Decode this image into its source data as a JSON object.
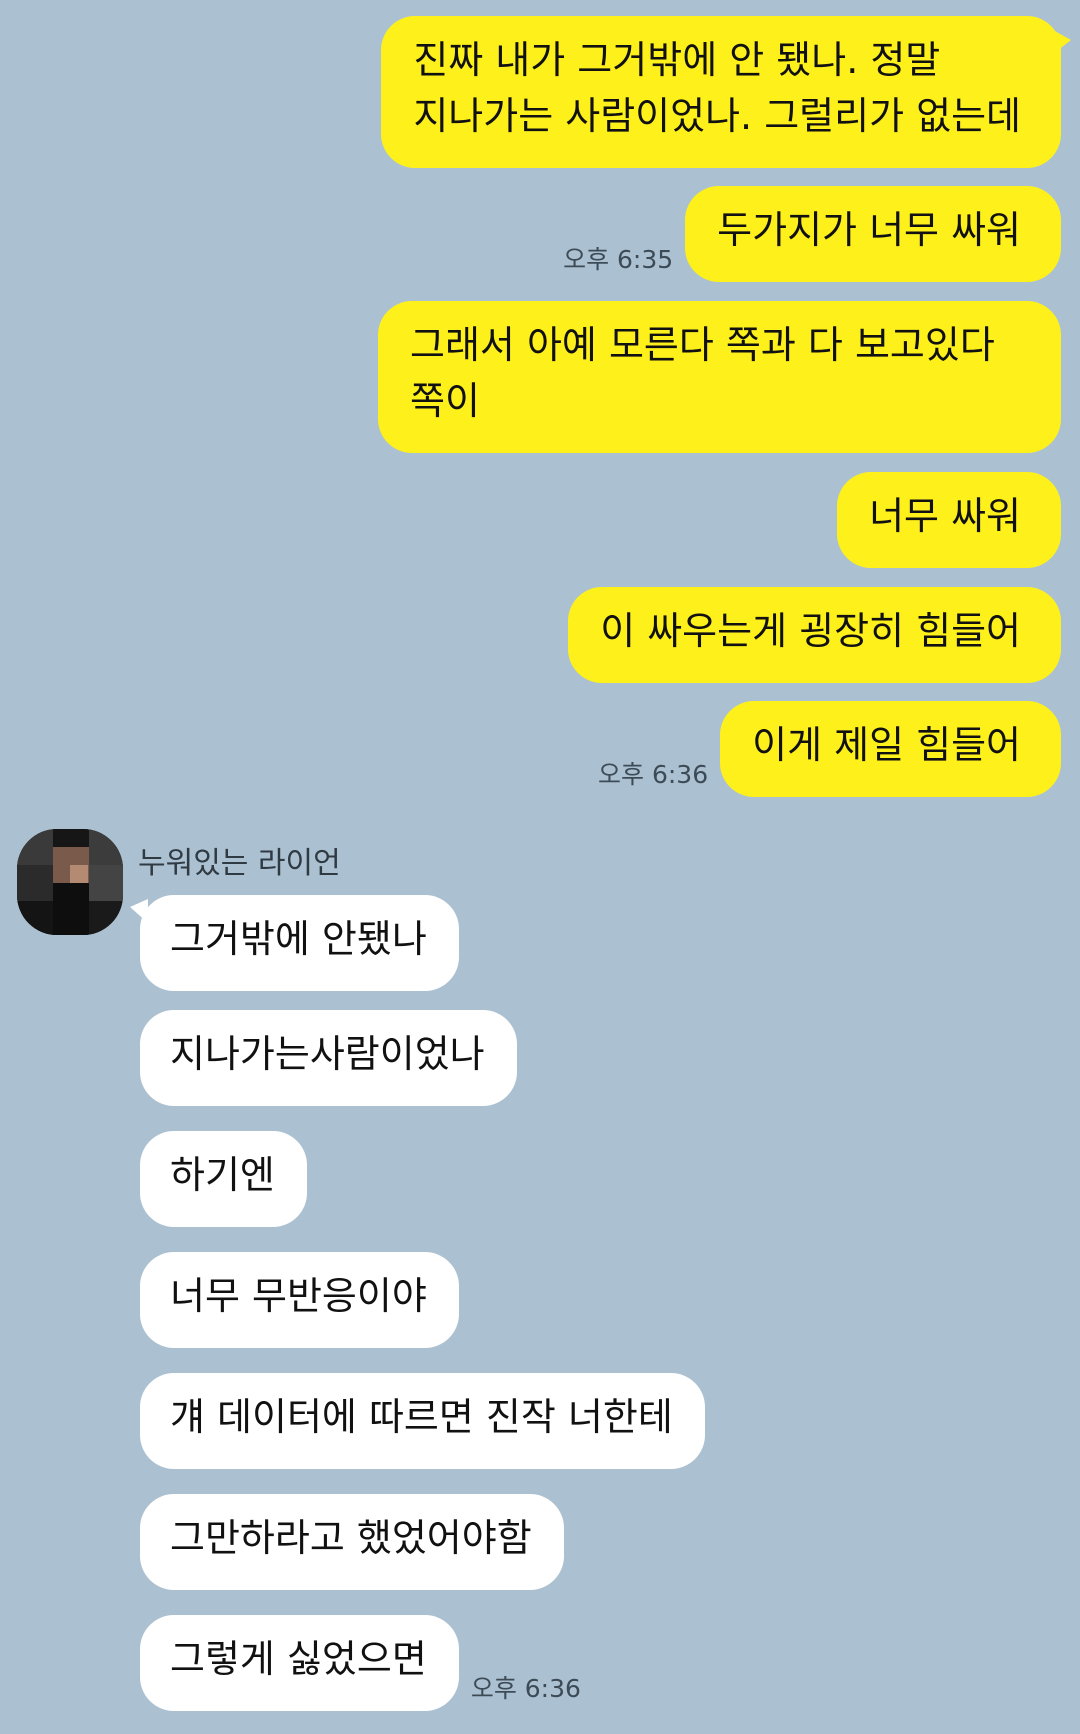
{
  "chat": {
    "outgoing": [
      {
        "text": "진짜 내가 그거밖에 안 됐나. 정말\n지나가는 사람이었나. 그럴리가 없는데",
        "time": ""
      },
      {
        "text": "두가지가 너무 싸워",
        "time": "오후 6:35"
      },
      {
        "text": "그래서 아예 모른다 쪽과 다 보고있다\n쪽이",
        "time": ""
      },
      {
        "text": "너무 싸워",
        "time": ""
      },
      {
        "text": "이 싸우는게 굉장히 힘들어",
        "time": ""
      },
      {
        "text": "이게 제일 힘들어",
        "time": "오후 6:36"
      }
    ],
    "sender_name": "누워있는 라이언",
    "incoming": [
      {
        "text": "그거밖에 안됐나",
        "time": ""
      },
      {
        "text": "지나가는사람이었나",
        "time": ""
      },
      {
        "text": "하기엔",
        "time": ""
      },
      {
        "text": "너무 무반응이야",
        "time": ""
      },
      {
        "text": "걔 데이터에 따르면 진작 너한테",
        "time": ""
      },
      {
        "text": "그만하라고 했었어야함",
        "time": ""
      },
      {
        "text": "그렇게 싫었으면",
        "time": "오후 6:36"
      }
    ]
  },
  "colors": {
    "background": "#abc1d1",
    "outgoing_bubble": "#fef01b",
    "incoming_bubble": "#ffffff"
  },
  "icons": {
    "avatar": "pixelated-profile-avatar"
  }
}
